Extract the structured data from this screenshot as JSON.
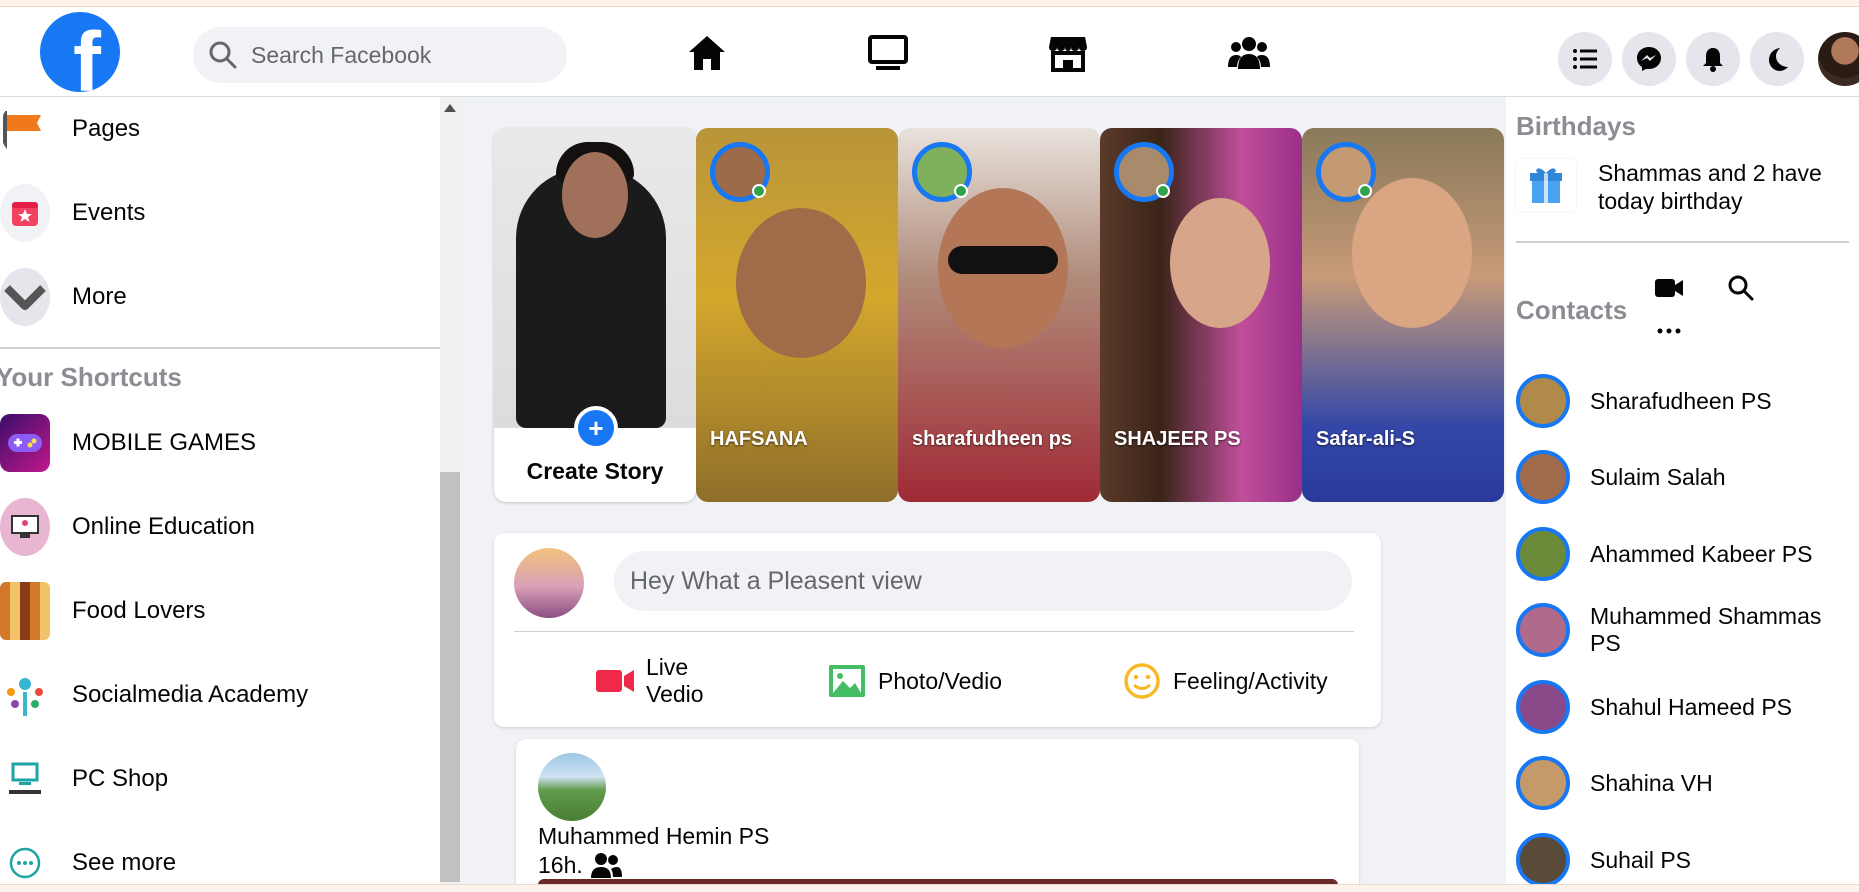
{
  "header": {
    "logo_letter": "f",
    "search_placeholder": "Search Facebook",
    "nav": [
      "home-icon",
      "watch-icon",
      "marketplace-icon",
      "groups-icon"
    ],
    "actions": [
      "menu-list-icon",
      "messenger-icon",
      "notifications-icon",
      "dark-mode-icon"
    ],
    "brand_color": "#1877f2"
  },
  "left": {
    "items": [
      {
        "label": "Pages",
        "icon": "flag-icon"
      },
      {
        "label": "Events",
        "icon": "calendar-star-icon"
      },
      {
        "label": "More",
        "icon": "chevron-down-icon"
      }
    ],
    "shortcuts_heading": "Your Shortcuts",
    "shortcuts": [
      {
        "label": "MOBILE GAMES"
      },
      {
        "label": "Online Education"
      },
      {
        "label": "Food Lovers"
      },
      {
        "label": "Socialmedia Academy"
      },
      {
        "label": "PC Shop"
      },
      {
        "label": "See more"
      }
    ]
  },
  "stories": {
    "create_label": "Create Story",
    "items": [
      {
        "name": "HAFSANA"
      },
      {
        "name": "sharafudheen ps"
      },
      {
        "name": "SHAJEER PS"
      },
      {
        "name": "Safar-ali-S"
      }
    ]
  },
  "composer": {
    "placeholder": "Hey What a Pleasent view",
    "actions": [
      {
        "line1": "Live",
        "line2": "Vedio"
      },
      {
        "label": "Photo/Vedio"
      },
      {
        "label": "Feeling/Activity"
      }
    ]
  },
  "post": {
    "author": "Muhammed Hemin PS",
    "time": "16h."
  },
  "right": {
    "birthdays_heading": "Birthdays",
    "birthday_text": "Shammas and 2 have today birthday",
    "contacts_heading": "Contacts",
    "contacts": [
      {
        "name": "Sharafudheen PS"
      },
      {
        "name": "Sulaim Salah"
      },
      {
        "name": "Ahammed Kabeer PS"
      },
      {
        "name": "Muhammed Shammas PS"
      },
      {
        "name": "Shahul Hameed PS"
      },
      {
        "name": "Shahina VH"
      },
      {
        "name": "Suhail PS"
      }
    ]
  }
}
